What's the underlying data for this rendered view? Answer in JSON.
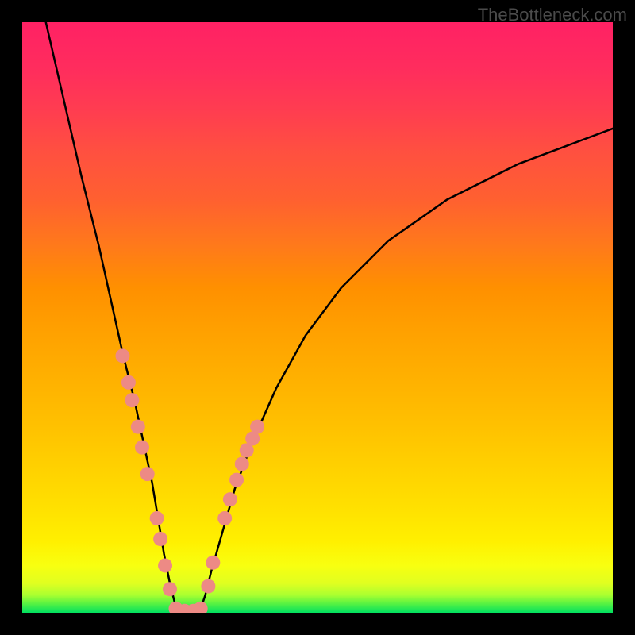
{
  "watermark": "TheBottleneck.com",
  "chart_data": {
    "type": "line",
    "title": "",
    "xlabel": "",
    "ylabel": "",
    "xlim": [
      0,
      100
    ],
    "ylim": [
      0,
      100
    ],
    "grid": false,
    "curve_left": {
      "x": [
        4,
        7,
        10,
        13,
        15,
        17,
        19,
        20.5,
        22,
        23,
        24,
        25,
        26,
        27
      ],
      "y": [
        100,
        87,
        74,
        62,
        53,
        44,
        36,
        29,
        22,
        16,
        10,
        5,
        1,
        0
      ]
    },
    "curve_right": {
      "x": [
        30,
        31,
        32,
        34,
        36,
        39,
        43,
        48,
        54,
        62,
        72,
        84,
        100
      ],
      "y": [
        0,
        3,
        7,
        14,
        21,
        29,
        38,
        47,
        55,
        63,
        70,
        76,
        82
      ]
    },
    "dots": [
      {
        "x": 17.0,
        "y": 43.5
      },
      {
        "x": 18.0,
        "y": 39.0
      },
      {
        "x": 18.6,
        "y": 36.0
      },
      {
        "x": 19.6,
        "y": 31.5
      },
      {
        "x": 20.3,
        "y": 28.0
      },
      {
        "x": 21.2,
        "y": 23.5
      },
      {
        "x": 22.8,
        "y": 16.0
      },
      {
        "x": 23.4,
        "y": 12.5
      },
      {
        "x": 24.2,
        "y": 8.0
      },
      {
        "x": 25.0,
        "y": 4.0
      },
      {
        "x": 26.0,
        "y": 0.7
      },
      {
        "x": 27.5,
        "y": 0.3
      },
      {
        "x": 29.0,
        "y": 0.3
      },
      {
        "x": 30.2,
        "y": 0.7
      },
      {
        "x": 31.5,
        "y": 4.5
      },
      {
        "x": 32.3,
        "y": 8.5
      },
      {
        "x": 34.3,
        "y": 16.0
      },
      {
        "x": 35.2,
        "y": 19.2
      },
      {
        "x": 36.3,
        "y": 22.5
      },
      {
        "x": 37.2,
        "y": 25.2
      },
      {
        "x": 38.0,
        "y": 27.5
      },
      {
        "x": 39.0,
        "y": 29.5
      },
      {
        "x": 39.8,
        "y": 31.5
      }
    ],
    "colors": {
      "curve": "#000000",
      "dot_fill": "#ed8a85",
      "dot_stroke": "#a13a3a"
    }
  }
}
